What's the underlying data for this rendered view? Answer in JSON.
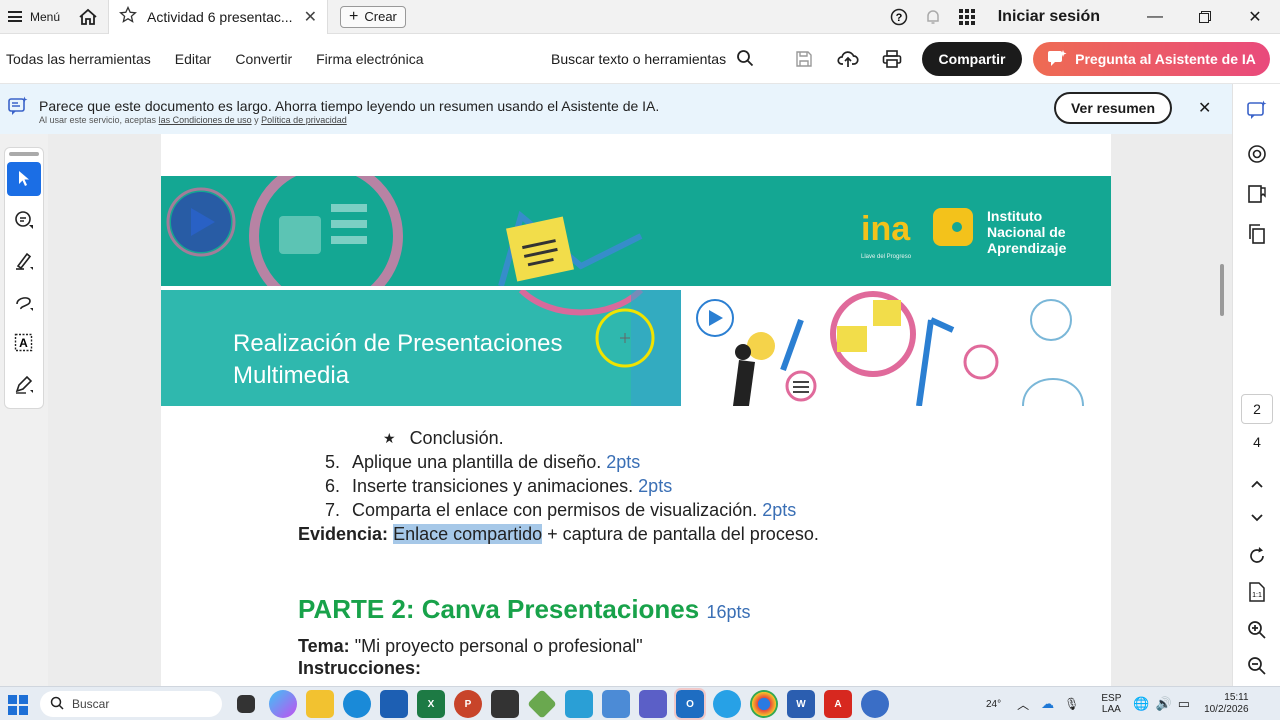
{
  "titlebar": {
    "menu_label": "Menú",
    "tab_title": "Actividad 6 presentac...",
    "create_label": "Crear",
    "signin_label": "Iniciar sesión"
  },
  "toolbar": {
    "all_tools": "Todas las herramientas",
    "edit": "Editar",
    "convert": "Convertir",
    "esign": "Firma electrónica",
    "search_label": "Buscar texto o herramientas",
    "share_label": "Compartir",
    "ai_label": "Pregunta al Asistente de IA"
  },
  "notice": {
    "main": "Parece que este documento es largo. Ahorra tiempo leyendo un resumen usando el Asistente de IA.",
    "sub_prefix": "Al usar este servicio, aceptas",
    "terms_link": "las Condiciones de uso",
    "sub_and": "y",
    "privacy_link": "Política de privacidad",
    "button_label": "Ver resumen"
  },
  "document": {
    "banner_title_line1": "Realización de Presentaciones",
    "banner_title_line2": "Multimedia",
    "logo_text": "ina",
    "logo_tagline": "Llave del Progreso",
    "institute_line1": "Instituto",
    "institute_line2": "Nacional de",
    "institute_line3": "Aprendizaje",
    "bullet_text": "Conclusión.",
    "items": [
      {
        "num": "5.",
        "text": "Aplique una plantilla de diseño.",
        "pts": "2pts"
      },
      {
        "num": "6.",
        "text": "Inserte transiciones y animaciones.",
        "pts": "2pts"
      },
      {
        "num": "7.",
        "text": "Comparta el enlace con permisos de visualización.",
        "pts": "2pts"
      }
    ],
    "evidence_label": "Evidencia:",
    "evidence_highlight": "Enlace compartido",
    "evidence_rest": " + captura de pantalla del proceso.",
    "part2_title": "PARTE 2: Canva Presentaciones",
    "part2_pts": "16pts",
    "tema_label": "Tema:",
    "tema_value": " \"Mi proyecto personal o profesional\"",
    "instructions_label": "Instrucciones:"
  },
  "right_rail": {
    "current_page": "2",
    "total_pages": "4"
  },
  "taskbar": {
    "search_label": "Buscar",
    "temperature": "24°",
    "lang_line1": "ESP",
    "lang_line2": "LAA",
    "time": "15:11",
    "date": "10/2/2026"
  },
  "colors": {
    "share_bg": "#1b1b1b",
    "ai_gradient_start": "#ee6b53",
    "ai_gradient_end": "#e94a7c",
    "banner_teal": "#14a793",
    "part2_green": "#18a24a",
    "pts_blue": "#3a6fb5",
    "highlight": "#a6c8e8",
    "active_tool": "#1b6ee5"
  }
}
